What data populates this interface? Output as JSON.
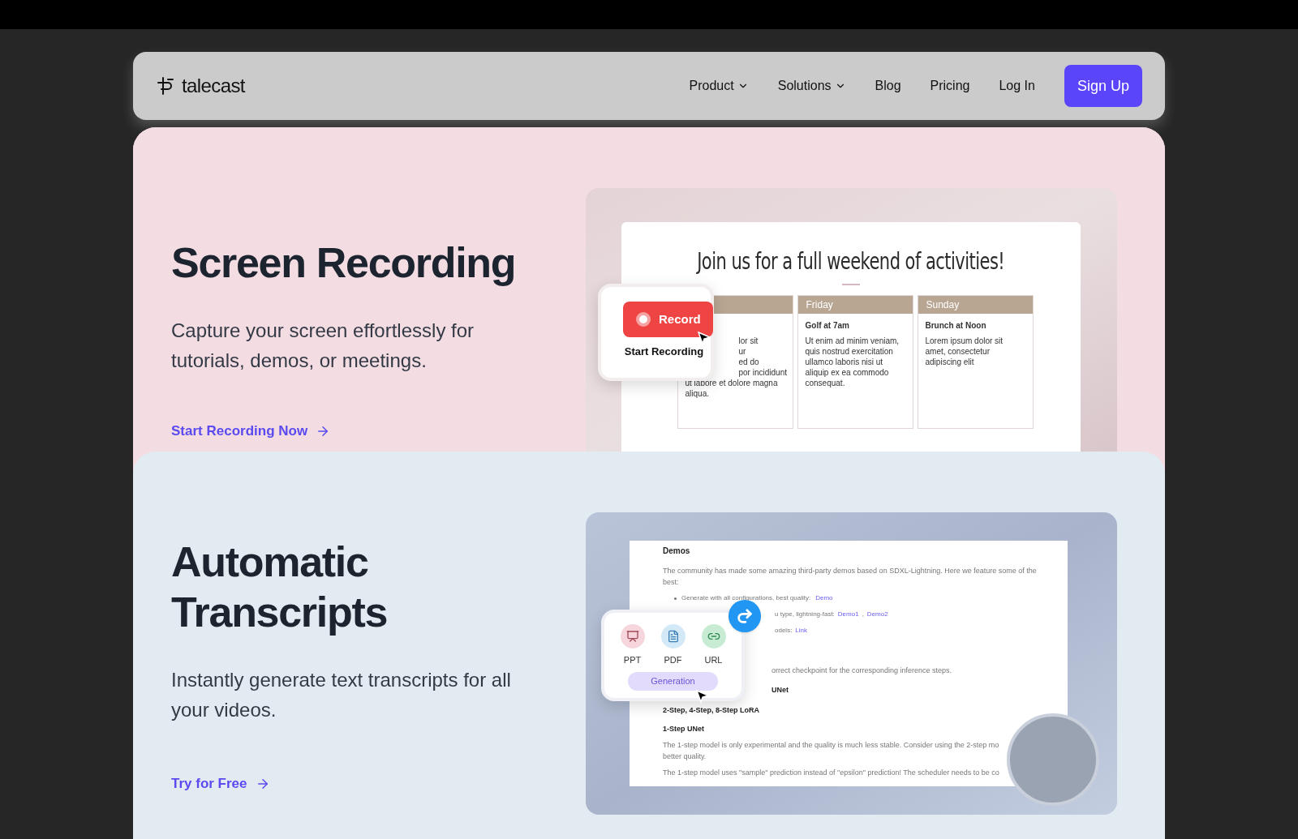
{
  "nav": {
    "logo": "talecast",
    "links": [
      {
        "label": "Product",
        "dropdown": true
      },
      {
        "label": "Solutions",
        "dropdown": true
      },
      {
        "label": "Blog",
        "dropdown": false
      },
      {
        "label": "Pricing",
        "dropdown": false
      },
      {
        "label": "Log In",
        "dropdown": false
      }
    ],
    "cta": "Sign Up"
  },
  "sections": [
    {
      "kind": "recording",
      "title": "Screen Recording",
      "description": "Capture your screen effortlessly for tutorials, demos, or meetings.",
      "cta": "Start Recording Now",
      "mockup": {
        "heading": "Join us for a full weekend of activities!",
        "columns": [
          {
            "partial_lines": [
              "lor sit",
              "ur",
              "ed do",
              "por incididunt"
            ],
            "lines": [
              "ut labore et dolore magna",
              "aliqua."
            ]
          },
          {
            "day": "Friday",
            "event": "Golf at 7am",
            "lines": [
              "Ut enim ad minim veniam, quis nostrud exercitation ullamco laboris nisi ut aliquip ex ea commodo consequat."
            ]
          },
          {
            "day": "Sunday",
            "event": "Brunch at Noon",
            "lines": [
              "Lorem ipsum dolor sit amet, consectetur adipiscing elit"
            ]
          }
        ],
        "popup": {
          "button": "Record",
          "label": "Start Recording"
        }
      }
    },
    {
      "kind": "transcript",
      "title": "Automatic Transcripts",
      "description": "Instantly generate text transcripts for all your videos.",
      "cta": "Try for Free",
      "mockup": {
        "doc_title": "Demos",
        "intro": "The community has made some amazing third-party demos based on SDXL-Lightning. Here we feature some of the best:",
        "bullets": [
          {
            "text": "Generate with all configurations, best quality:",
            "links": [
              "Demo"
            ]
          }
        ],
        "partial_bullets": [
          {
            "text": "u type, lightning-fast:",
            "links": [
              "Demo1",
              "Demo2"
            ]
          },
          {
            "text": "odels:",
            "links": [
              "Link"
            ]
          }
        ],
        "link_separator": ",",
        "checkpoint": "orrect checkpoint for the corresponding inference steps.",
        "subheads": [
          "UNet",
          "2-Step, 4-Step, 8-Step LoRA",
          "1-Step UNet"
        ],
        "paragraphs": [
          "The 1-step model is only experimental and the quality is much less stable. Consider using the 2-step mo",
          "better quality.",
          "The 1-step model uses \"sample\" prediction instead of \"epsilon\" prediction! The scheduler needs to be co"
        ],
        "formats": [
          {
            "label": "PPT",
            "kind": "ppt"
          },
          {
            "label": "PDF",
            "kind": "pdf"
          },
          {
            "label": "URL",
            "kind": "url"
          }
        ],
        "button": "Generation"
      }
    }
  ]
}
